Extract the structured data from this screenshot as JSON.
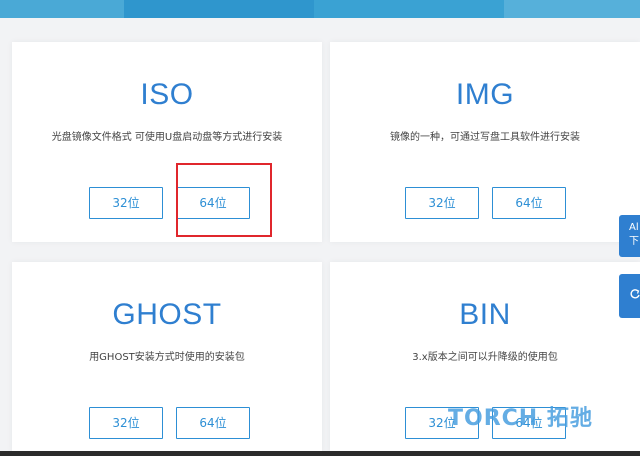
{
  "cards": [
    {
      "title": "ISO",
      "description": "光盘镜像文件格式 可使用U盘启动盘等方式进行安装",
      "btn32": "32位",
      "btn64": "64位"
    },
    {
      "title": "IMG",
      "description": "镜像的一种，可通过写盘工具软件进行安装",
      "btn32": "32位",
      "btn64": "64位"
    },
    {
      "title": "GHOST",
      "description": "用GHOST安装方式时使用的安装包",
      "btn32": "32位",
      "btn64": "64位"
    },
    {
      "title": "BIN",
      "description": "3.x版本之间可以升降级的使用包",
      "btn32": "32位",
      "btn64": "64位"
    }
  ],
  "side_tab": {
    "line1": "Al",
    "line2": "下"
  },
  "watermark": "TORCH 拓驰",
  "colors": {
    "accent": "#2f7fd0",
    "button_border": "#2d8fd5",
    "highlight": "#e0262c"
  },
  "icons": {
    "side_tab_2": "refresh-icon"
  }
}
